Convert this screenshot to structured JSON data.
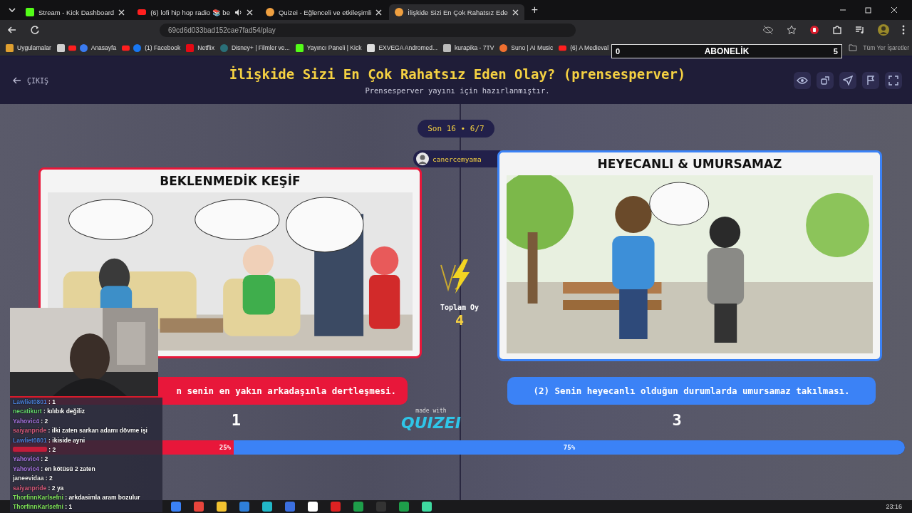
{
  "browser": {
    "tabs": [
      {
        "title": "Stream - Kick Dashboard",
        "audio": false,
        "selected": false
      },
      {
        "title": "(6) lofi hip hop radio 📚 be",
        "audio": true,
        "selected": false
      },
      {
        "title": "Quizei - Eğlenceli ve etkileşimli",
        "audio": false,
        "selected": false
      },
      {
        "title": "İlişkide Sizi En Çok Rahatsız Ede",
        "audio": false,
        "selected": true
      }
    ],
    "new_tab": "+",
    "url": "69cd6d033bad152cae7fad54/play",
    "bookmarks": [
      "Uygulamalar",
      "Anasayfa",
      "(1) Facebook",
      "Netflix",
      "Disney+ | Filmler ve...",
      "Yayıncı Paneli | Kick",
      "EXVEGA Andromed...",
      "kurapika - 7TV",
      "Suno | AI Music",
      "(6) A Medieval"
    ],
    "all_bookmarks": "Tüm Yer İşaretler"
  },
  "subscription_goal": {
    "min": "0",
    "label": "ABONELİK",
    "max": "5"
  },
  "header": {
    "exit": "ÇIKIŞ",
    "title": "İlişkide Sizi En Çok Rahatsız Eden Olay? (prensesperver)",
    "subtitle": "Prensesperver yayını için hazırlanmıştır."
  },
  "round": "Son 16 • 6/7",
  "voter": "canercemyama",
  "options": [
    {
      "title": "BEKLENMEDİK KEŞİF",
      "caption": "n senin en yakın arkadaşınla dertleşmesi.",
      "votes": "1",
      "color": "#e8173a"
    },
    {
      "title": "HEYECANLI & UMURSAMAZ",
      "caption": "(2) Senin heyecanlı olduğun durumlarda umursamaz takılması.",
      "votes": "3",
      "color": "#3b82f6"
    }
  ],
  "total": {
    "label": "Toplam Oy",
    "value": "4"
  },
  "made_with": "made with",
  "logo": "QUIZEI",
  "results": [
    {
      "label": "25%",
      "level": 0.25
    },
    {
      "label": "75%",
      "level": 0.75
    }
  ],
  "chat": [
    {
      "user": "Lawliet0801",
      "color": "#4a7fd6",
      "text": ": 1"
    },
    {
      "user": "necatikurt",
      "color": "#62d66a",
      "text": ": kılıbık değiliz"
    },
    {
      "user": "Yahovic4",
      "color": "#a774e0",
      "text": ": 2"
    },
    {
      "user": "saiyanpride",
      "color": "#d65a7a",
      "text": ": ilki zaten sarkan adamı dövme işi"
    },
    {
      "user": "Lawliet0801",
      "color": "#4a7fd6",
      "text": ": ikiside ayni"
    },
    {
      "color": "#c21c3a",
      "text": ": 2"
    },
    {
      "user": "Yahovic4",
      "color": "#a774e0",
      "text": ": 2"
    },
    {
      "user": "Yahovic4",
      "color": "#a774e0",
      "text": ": en kötüsü 2 zaten"
    },
    {
      "user": "janeevidaa",
      "color": "#e8e8e8",
      "text": ": 2"
    },
    {
      "user": "saiyanpride",
      "color": "#d65a7a",
      "text": ": 2 ya"
    },
    {
      "user": "ThorfinnKarlsefni",
      "color": "#7ee05a",
      "text": ": arkdasimla aram bozulur"
    },
    {
      "user": "ThorfinnKarlsefni",
      "color": "#7ee05a",
      "text": ": 1"
    }
  ],
  "taskbar": {
    "time": "23:16"
  }
}
